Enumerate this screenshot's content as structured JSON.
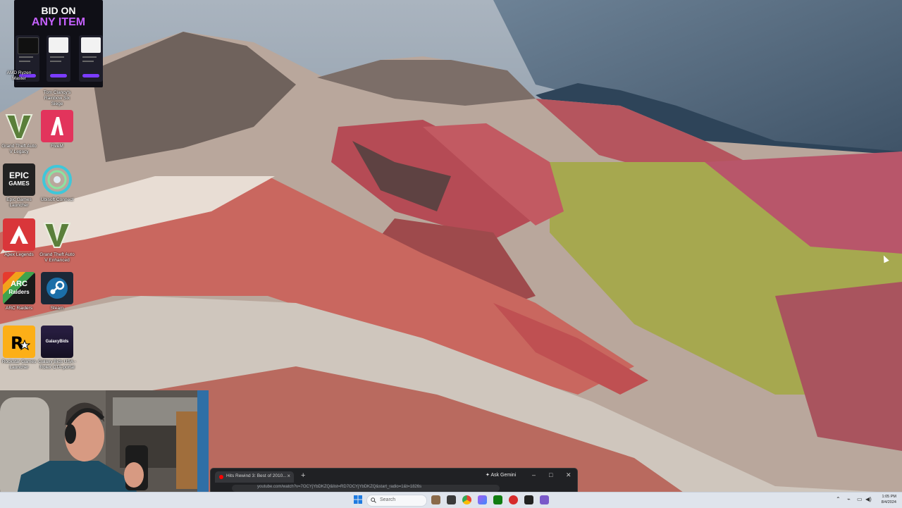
{
  "ad": {
    "line1": "BID ON",
    "line2": "ANY ITEM"
  },
  "desktop_icons": [
    {
      "label": "AMD Ryzen Master",
      "icon": "amd-ryzen-icon"
    },
    {
      "label": "Tom Clancy's Rainbow Six Siege",
      "icon": "rainbow-six-icon"
    },
    {
      "label": "Grand Theft Auto V Legacy",
      "icon": "gta-v-icon"
    },
    {
      "label": "FiveM",
      "icon": "fivem-icon"
    },
    {
      "label": "Epic Games Launcher",
      "icon": "epic-games-icon",
      "tile_text_1": "EPIC",
      "tile_text_2": "GAMES"
    },
    {
      "label": "Ubisoft Connect",
      "icon": "ubisoft-icon"
    },
    {
      "label": "Apex Legends",
      "icon": "apex-icon"
    },
    {
      "label": "Grand Theft Auto V Enhanced",
      "icon": "gta-v-icon"
    },
    {
      "label": "ARC Raiders",
      "icon": "arc-raiders-icon",
      "tile_text_1": "ARC",
      "tile_text_2": "Raiders"
    },
    {
      "label": "Steam",
      "icon": "steam-icon"
    },
    {
      "label": "Rockstar Games Launcher",
      "icon": "rockstar-icon"
    },
    {
      "label": "Galaxy Bids USA - Rolex CTA-portal",
      "icon": "galaxy-bids-icon",
      "tile_text_1": "GalaxyBids"
    }
  ],
  "browser": {
    "tab_title": "Hits Rewind 3: Best of 2010...",
    "new_tab": "+",
    "ask_gemini": "Ask Gemini",
    "url": "youtube.com/watch?v=7OCYjYbDKZQ&list=RD7OCYjYbDKZQ&start_radio=1&t=1826s",
    "min": "–",
    "max": "□",
    "close": "✕"
  },
  "taskbar": {
    "search_placeholder": "Search",
    "time": "1:05 PM",
    "date": "8/4/2024"
  },
  "colors": {
    "ad_accent": "#c561ff",
    "taskbar_bg": "#dfe4ec",
    "browser_bg": "#202124"
  }
}
